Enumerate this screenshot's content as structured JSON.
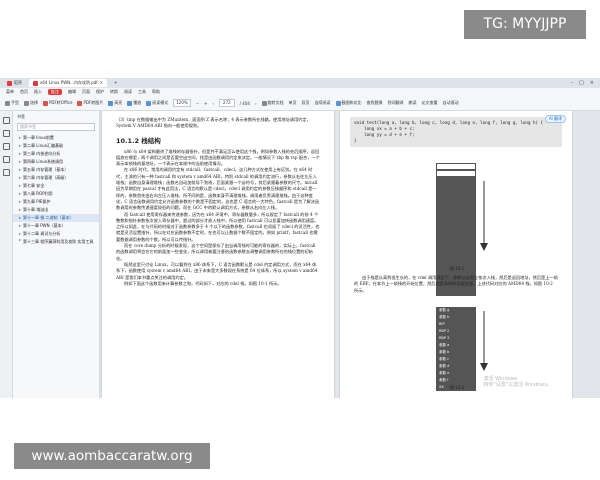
{
  "overlay": {
    "tag": "TG: MYYJJPP",
    "watermark": "www.aombaccaratw.org"
  },
  "tabs": [
    {
      "label": "稻壳",
      "color": "#e5393a"
    },
    {
      "label": "x64 Linux PWN...内存攻防.pdf",
      "color": "#e5393a",
      "active": true
    }
  ],
  "menu": [
    "菜单",
    "首页",
    "插入",
    "批注",
    "编辑",
    "页面",
    "保护",
    "转换",
    "阅读",
    "工具",
    "帮助"
  ],
  "toolbar": {
    "items": [
      "手型",
      "选择",
      "PDF转Office",
      "PDF转图片",
      "高亮",
      "播放",
      "阅读模式",
      "旋转文档",
      "单页",
      "双页",
      "连续阅读"
    ],
    "zoom": "120%",
    "page_current": "272",
    "page_total": "/ 404",
    "right_items": [
      "截图和对比",
      "查找替换",
      "划词翻译",
      "朗读",
      "论文查重",
      "自动滚动"
    ],
    "search_placeholder": "查找功能、文档内容"
  },
  "sidebar": {
    "title": "书签",
    "search_placeholder": "搜索书签",
    "items": [
      {
        "label": "第一章 linux前置"
      },
      {
        "label": "第二章 Linux汇编基础"
      },
      {
        "label": "第三章 内核逆向分析"
      },
      {
        "label": "第四章 Linux系统调用"
      },
      {
        "label": "第五章 内存管理（基本）"
      },
      {
        "label": "第六章 内存管理（高级）"
      },
      {
        "label": "第七章 安全"
      },
      {
        "label": "第八章 ROP利用"
      },
      {
        "label": "第九章 PIE保护"
      },
      {
        "label": "第十章 堆溢出"
      },
      {
        "label": "第十一章 栈 二进制（基本）",
        "active": true
      },
      {
        "label": "第十一章 PWN（基本）"
      },
      {
        "label": "第十二章 调试与分析"
      },
      {
        "label": "第十三章 程序漏洞利用及攻防 实用工具"
      }
    ]
  },
  "doc": {
    "left_page": {
      "para_top": "（3）tmp 在数据输出中为 ZMuntem、面面到 Z 表示名称；4 表示参数所在线路。使用地址调用约定，System V AMD64 ABI 指向一般使用规则。",
      "section": "10.1.2  栈结构",
      "paragraphs": [
        "x86 与 x64 架构最终了堆栈的存器指针，但是并不满足怎么使用这个栈，例如参数入栈的先后顺序、返回值放在哪里，两个调用之间是否要空出空间，找是由函数调用约定来决定。一般情况下 rbp 和 rsp 配合，一个表示本帧栈的基地址，一个表示在本帧中的当前使用情况。",
        "在 x86 时代，常用的调用约定有 stdcall、fastcall、cdecl，这几种方式在使用上有区别。在 x64 时代，主流的只有一种 fastcall 和 system v amd64 ABI，特别 stdcall 的调用约定流行，参数从右往左压入堆栈；函数自身清理堆栈；函数名自动加前导下划线，后面紧跟一个@符号，其后紧跟着参数的尺寸。mlcall 因为早期用在 pascal 才有此用法，C 语言的默认是 cdecl，cdecl 调用约定的参数压栈顺序和 stdcall 是一样的，参数首先由右向左压入堆栈，所不同的是，函数本身不清理堆栈，调用者负责清理堆栈。由于这种变化，C 语言函数调用约定允许函数参数的个数是不固定的，这也是 C 语言的一大特色。fastcall 是为了解决函数调用时参数传递速度较低的问题。而在 GCC 中的默认调用方式，参数从右向左入栈。",
        "而 fastcall 使用寄存器来传递参数，因为在 x64 环境中，寄存器数量多，所以规定了 fastcall 的前 4 个整数和指针参数依次放入寄存器中，超过的部分才放入栈中，所以使用 fastcall 可以显著加快函数调用速度。之所以如此，在与代码的时候对于函数参数多于 4 个以下的函数参数，fastcall 也须留了 cdecl 的灵活性，也就是灵活设置指针，所以在对应函数参数不定时，在也可以让数据个数不固定的，例如 printf，fastcall 也需要数据调用参数的个数，所以可以传指针。",
        "而在 core dump 分析的时候发现，这个空间是保存了由当调用栈时可能的寄存器的，实际上，fastcall 的函数调用将会在它的前面加一些变化，所以调用者要注意给函数参数去调整调用参数所在的栈位置的初始化。",
        "既然这里只讨论 Linux，可以看到在 x86 体系下，C 语言函数默认是 cdel 约定调用方式，而在 x64 体系下，函数使用 system v amd64 ABI，由于未来是大多数现在系统是 64 位体系，所以 system v amd64 ABI 是我们本书重点关注的调用约定。",
        "例如下面这个函数用来计算参数之和，代码如下，对应的 cdel 栈，如图 10-1 所示。"
      ]
    },
    "right_page": {
      "float_btn": "AI 翻译",
      "code_lines": [
        "void test(long a, long b, long c, long d, long e, long f, long g, long h) {",
        "    long xx = a + b + c;",
        "    long yy = d + e + f;",
        "}"
      ],
      "fig1_caption": "图 10-1",
      "fig1_cells": [
        "",
        "",
        "",
        "",
        "",
        "",
        "",
        "",
        "",
        "",
        "",
        "",
        "",
        "",
        "",
        "",
        "",
        "",
        ""
      ],
      "mid_text": "由于栈是从高到低生长的，在 cdel 调用规定下，参数从右到左依次入栈，然后是返回地址，然后是上一帧的 EBP。在本节上一帧栈的开始位置，然后就是具体的局部变量，上述代码对应的 AMD64 栈，如图 10-2 所示。",
      "fig2_caption": "图 10-2",
      "fig2_labels": [
        "参数 g",
        "参数 h",
        "RIP",
        "RBP 2",
        "RBP 3",
        "参数 a",
        "参数 b",
        "参数 c",
        "参数 d",
        "参数 e",
        "参数 f",
        "XX"
      ],
      "activate_line1": "激活 Windows",
      "activate_line2": "转到\"设置\"以激活 Windows。"
    }
  }
}
